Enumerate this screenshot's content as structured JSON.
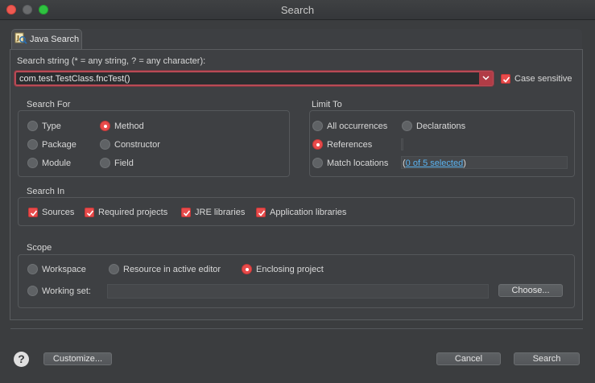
{
  "window": {
    "title": "Search"
  },
  "tab": {
    "label": "Java Search"
  },
  "search_string": {
    "label": "Search string (* = any string, ? = any character):",
    "value": "com.test.TestClass.fncTest()",
    "case_sensitive_label": "Case sensitive",
    "case_sensitive_checked": true
  },
  "search_for": {
    "title": "Search For",
    "options": [
      {
        "label": "Type",
        "selected": false
      },
      {
        "label": "Package",
        "selected": false
      },
      {
        "label": "Module",
        "selected": false
      },
      {
        "label": "Method",
        "selected": true
      },
      {
        "label": "Constructor",
        "selected": false
      },
      {
        "label": "Field",
        "selected": false
      }
    ]
  },
  "limit_to": {
    "title": "Limit To",
    "options": [
      {
        "label": "All occurrences",
        "selected": false
      },
      {
        "label": "Declarations",
        "selected": false
      },
      {
        "label": "References",
        "selected": true
      },
      {
        "label": "Match locations",
        "selected": false
      }
    ],
    "match_locations_open": "(",
    "match_locations_link": "0 of 5 selected",
    "match_locations_close": ")"
  },
  "search_in": {
    "title": "Search In",
    "options": [
      {
        "label": "Sources",
        "checked": true
      },
      {
        "label": "Required projects",
        "checked": true
      },
      {
        "label": "JRE libraries",
        "checked": true
      },
      {
        "label": "Application libraries",
        "checked": true
      }
    ]
  },
  "scope": {
    "title": "Scope",
    "options": [
      {
        "label": "Workspace",
        "selected": false
      },
      {
        "label": "Resource in active editor",
        "selected": false
      },
      {
        "label": "Enclosing project",
        "selected": true
      },
      {
        "label": "Working set:",
        "selected": false
      }
    ],
    "working_set_value": "",
    "choose_label": "Choose..."
  },
  "footer": {
    "help_symbol": "?",
    "customize_label": "Customize...",
    "cancel_label": "Cancel",
    "search_label": "Search"
  },
  "colors": {
    "accent": "#e84b4b",
    "background": "#3b3d3f",
    "link": "#5ab3f0"
  }
}
